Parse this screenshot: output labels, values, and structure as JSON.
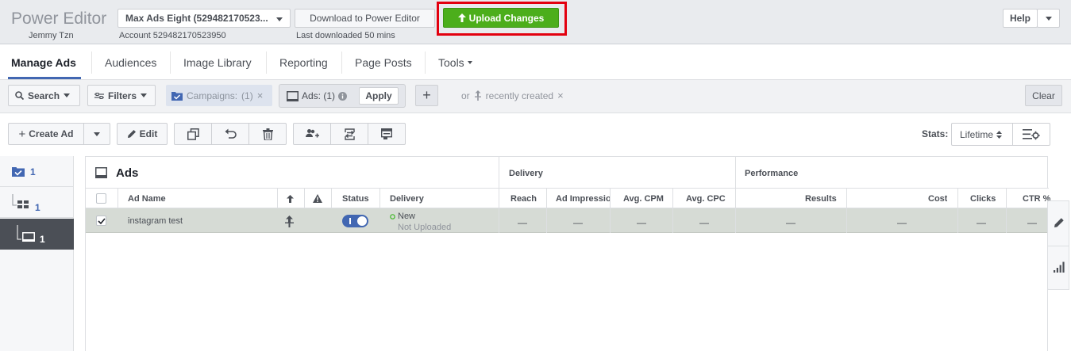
{
  "header": {
    "app_title": "Power Editor",
    "user_name": "Jemmy Tzn",
    "account_selector": "Max Ads Eight (529482170523...",
    "account_line": "Account 529482170523950",
    "download_label": "Download to Power Editor",
    "last_downloaded": "Last downloaded 50 mins",
    "upload_label": "Upload Changes",
    "help_label": "Help",
    "highlight_color": "#e3000f",
    "upload_color": "#4cae1b"
  },
  "tabs": [
    {
      "label": "Manage Ads",
      "active": true
    },
    {
      "label": "Audiences"
    },
    {
      "label": "Image Library"
    },
    {
      "label": "Reporting"
    },
    {
      "label": "Page Posts"
    },
    {
      "label": "Tools"
    }
  ],
  "filters": {
    "search_label": "Search",
    "filters_label": "Filters",
    "campaigns_chip": "Campaigns:",
    "campaigns_count": "(1)",
    "ads_chip": "Ads: (1)",
    "apply_label": "Apply",
    "or_label": "or",
    "recently_created": "recently created",
    "clear_label": "Clear"
  },
  "toolbar": {
    "create_ad_label": "Create Ad",
    "edit_label": "Edit",
    "stats_label": "Stats:",
    "stats_value": "Lifetime"
  },
  "levels": [
    {
      "count": "1",
      "icon": "campaign-icon"
    },
    {
      "count": "1",
      "icon": "adset-icon"
    },
    {
      "count": "1",
      "icon": "ad-icon",
      "active": true
    }
  ],
  "table": {
    "title": "Ads",
    "groups": {
      "delivery": "Delivery",
      "performance": "Performance"
    },
    "columns": {
      "ad_name": "Ad Name",
      "status": "Status",
      "delivery": "Delivery",
      "reach": "Reach",
      "impressions": "Ad Impressions",
      "cpm": "Avg. CPM",
      "cpc": "Avg. CPC",
      "results": "Results",
      "cost": "Cost",
      "clicks": "Clicks",
      "ctr": "CTR %"
    },
    "rows": [
      {
        "ad_name": "instagram test",
        "delivery_status": "New",
        "delivery_sub": "Not Uploaded",
        "dash": "—"
      }
    ]
  }
}
